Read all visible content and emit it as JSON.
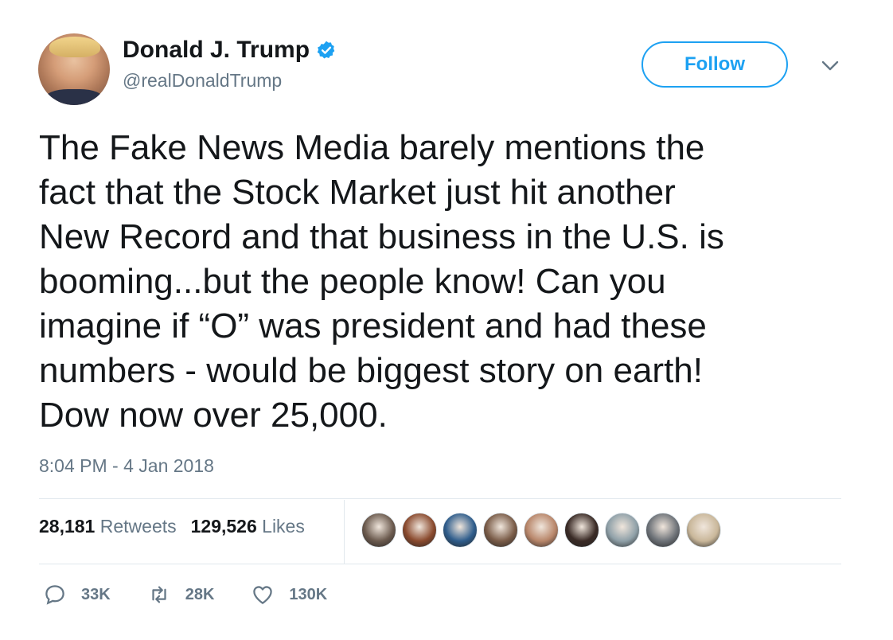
{
  "author": {
    "name": "Donald J. Trump",
    "handle": "@realDonaldTrump",
    "verified": true
  },
  "follow_button": {
    "label": "Follow"
  },
  "tweet": {
    "text": "The Fake News Media barely mentions the\nfact that the Stock Market just hit another\nNew Record and that business in the U.S. is\nbooming...but the people know! Can you\nimagine if “O” was president and had these\nnumbers - would be biggest story on earth!\nDow now over 25,000.",
    "timestamp": "8:04 PM - 4 Jan 2018"
  },
  "stats": {
    "retweets_count": "28,181",
    "retweets_label": "Retweets",
    "likes_count": "129,526",
    "likes_label": "Likes"
  },
  "liker_avatars": [
    {
      "color": "#6b5a4e"
    },
    {
      "color": "#8a4a2e"
    },
    {
      "color": "#2f5d8c"
    },
    {
      "color": "#7a5c48"
    },
    {
      "color": "#b8866a"
    },
    {
      "color": "#3a2b26"
    },
    {
      "color": "#8fa0a8"
    },
    {
      "color": "#6d7278"
    },
    {
      "color": "#c9b79a"
    }
  ],
  "actions": {
    "reply_count": "33K",
    "retweet_count": "28K",
    "like_count": "130K"
  },
  "colors": {
    "accent": "#1da1f2",
    "secondary_text": "#657786",
    "primary_text": "#14171a",
    "divider": "#e1e8ed"
  }
}
